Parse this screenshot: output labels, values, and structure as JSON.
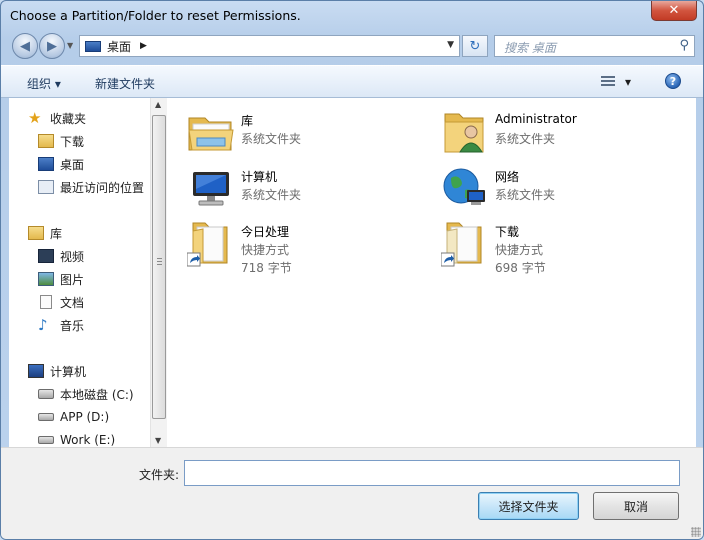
{
  "window": {
    "title": "Choose a Partition/Folder to reset Permissions.",
    "close_glyph": "✕"
  },
  "nav": {
    "back_glyph": "◀",
    "forward_glyph": "▶",
    "history_glyph": "▼",
    "address": "桌面",
    "address_sep": "▶",
    "address_dd": "▼",
    "refresh_glyph": "↻",
    "search_placeholder": "搜索 桌面",
    "search_glyph": "⚲"
  },
  "toolbar": {
    "organize": "组织 ▾",
    "new_folder": "新建文件夹",
    "views_glyph": "▾",
    "help_glyph": "?"
  },
  "sidebar": {
    "favorites": {
      "label": "收藏夹",
      "items": [
        "下载",
        "桌面",
        "最近访问的位置"
      ]
    },
    "libraries": {
      "label": "库",
      "items": [
        "视频",
        "图片",
        "文档",
        "音乐"
      ]
    },
    "computer": {
      "label": "计算机",
      "items": [
        "本地磁盘 (C:)",
        "APP (D:)",
        "Work (E:)"
      ]
    }
  },
  "files": [
    {
      "name": "库",
      "sub1": "系统文件夹",
      "sub2": ""
    },
    {
      "name": "Administrator",
      "sub1": "系统文件夹",
      "sub2": ""
    },
    {
      "name": "计算机",
      "sub1": "系统文件夹",
      "sub2": ""
    },
    {
      "name": "网络",
      "sub1": "系统文件夹",
      "sub2": ""
    },
    {
      "name": "今日处理",
      "sub1": "快捷方式",
      "sub2": "718 字节"
    },
    {
      "name": "下载",
      "sub1": "快捷方式",
      "sub2": "698 字节"
    }
  ],
  "footer": {
    "filename_label": "文件夹:",
    "filename_value": "",
    "select_label": "选择文件夹",
    "cancel_label": "取消"
  },
  "colors": {
    "accent": "#3c7fb1",
    "title_bar": "#c9dcf2",
    "close_red": "#c23b25"
  }
}
